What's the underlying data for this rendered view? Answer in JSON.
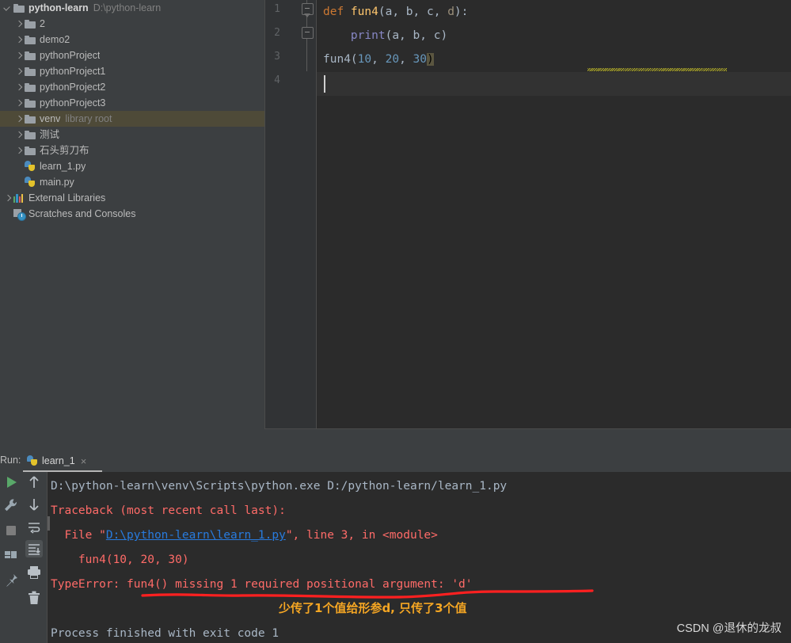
{
  "project": {
    "root": {
      "name": "python-learn",
      "path": "D:\\python-learn",
      "icon": "folder-icon",
      "expanded": true
    },
    "items": [
      {
        "label": "2",
        "icon": "folder-icon",
        "hint": "",
        "selected": false,
        "arrow": "collapsed"
      },
      {
        "label": "demo2",
        "icon": "folder-icon",
        "hint": "",
        "selected": false,
        "arrow": "collapsed"
      },
      {
        "label": "pythonProject",
        "icon": "folder-icon",
        "hint": "",
        "selected": false,
        "arrow": "collapsed"
      },
      {
        "label": "pythonProject1",
        "icon": "folder-icon",
        "hint": "",
        "selected": false,
        "arrow": "collapsed"
      },
      {
        "label": "pythonProject2",
        "icon": "folder-icon",
        "hint": "",
        "selected": false,
        "arrow": "collapsed"
      },
      {
        "label": "pythonProject3",
        "icon": "folder-icon",
        "hint": "",
        "selected": false,
        "arrow": "collapsed"
      },
      {
        "label": "venv",
        "icon": "folder-icon",
        "hint": "library root",
        "selected": true,
        "arrow": "collapsed"
      },
      {
        "label": "测试",
        "icon": "folder-icon",
        "hint": "",
        "selected": false,
        "arrow": "collapsed"
      },
      {
        "label": "石头剪刀布",
        "icon": "folder-icon",
        "hint": "",
        "selected": false,
        "arrow": "collapsed"
      },
      {
        "label": "learn_1.py",
        "icon": "python-file-icon",
        "hint": "",
        "selected": false,
        "arrow": "none"
      },
      {
        "label": "main.py",
        "icon": "python-file-icon",
        "hint": "",
        "selected": false,
        "arrow": "none"
      },
      {
        "label": "External Libraries",
        "icon": "library-icon",
        "hint": "",
        "selected": false,
        "arrow": "collapsed"
      },
      {
        "label": "Scratches and Consoles",
        "icon": "scratches-icon",
        "hint": "",
        "selected": false,
        "arrow": "none"
      }
    ]
  },
  "editor": {
    "line_numbers": [
      "1",
      "2",
      "3",
      "4"
    ],
    "lines": [
      {
        "n": 1,
        "tokens": [
          {
            "t": "def ",
            "c": "kw"
          },
          {
            "t": "fun4",
            "c": "fn"
          },
          {
            "t": "(",
            "c": "punct"
          },
          {
            "t": "a",
            "c": "param"
          },
          {
            "t": ", ",
            "c": "punct"
          },
          {
            "t": "b",
            "c": "param"
          },
          {
            "t": ", ",
            "c": "punct"
          },
          {
            "t": "c",
            "c": "param"
          },
          {
            "t": ", ",
            "c": "punct"
          },
          {
            "t": "d",
            "c": "dparam"
          },
          {
            "t": "):",
            "c": "punct"
          }
        ]
      },
      {
        "n": 2,
        "tokens": [
          {
            "t": "    ",
            "c": "punct"
          },
          {
            "t": "print",
            "c": "builtin"
          },
          {
            "t": "(",
            "c": "punct"
          },
          {
            "t": "a",
            "c": "param"
          },
          {
            "t": ", ",
            "c": "punct"
          },
          {
            "t": "b",
            "c": "param"
          },
          {
            "t": ", ",
            "c": "punct"
          },
          {
            "t": "c",
            "c": "param"
          },
          {
            "t": ")",
            "c": "punct"
          }
        ]
      },
      {
        "n": 3,
        "tokens": [
          {
            "t": "fun4",
            "c": "id-u"
          },
          {
            "t": "(",
            "c": "punct"
          },
          {
            "t": "10",
            "c": "num"
          },
          {
            "t": ", ",
            "c": "punct"
          },
          {
            "t": "20",
            "c": "num"
          },
          {
            "t": ", ",
            "c": "punct"
          },
          {
            "t": "30",
            "c": "num"
          },
          {
            "t": ")",
            "c": "brace-hl"
          }
        ]
      },
      {
        "n": 4,
        "tokens": []
      }
    ],
    "plain_text": "def fun4(a, b, c, d):\n    print(a, b, c)\nfun4(10, 20, 30)\n",
    "current_line": 4
  },
  "run_panel": {
    "label": "Run:",
    "tab": {
      "label": "learn_1",
      "icon": "python-file-icon",
      "close": "×"
    },
    "left_toolbar": [
      {
        "name": "run-icon"
      },
      {
        "name": "wrench-icon"
      },
      {
        "name": "stop-icon"
      },
      {
        "name": "layout-icon"
      },
      {
        "name": "pin-icon"
      }
    ],
    "console_toolbar": [
      {
        "name": "arrow-up-icon"
      },
      {
        "name": "arrow-down-icon"
      },
      {
        "name": "soft-wrap-icon"
      },
      {
        "name": "scroll-to-end-icon",
        "active": true
      },
      {
        "name": "print-icon"
      },
      {
        "name": "trash-icon"
      }
    ],
    "console": [
      {
        "segments": [
          {
            "t": "D:\\python-learn\\venv\\Scripts\\python.exe D:/python-learn/learn_1.py",
            "c": "o-gray"
          }
        ]
      },
      {
        "segments": [
          {
            "t": "Traceback (most recent call last):",
            "c": "o-red"
          }
        ]
      },
      {
        "segments": [
          {
            "t": "  File \"",
            "c": "o-red"
          },
          {
            "t": "D:\\python-learn\\learn_1.py",
            "c": "o-link"
          },
          {
            "t": "\", line 3, in <module>",
            "c": "o-red"
          }
        ]
      },
      {
        "segments": [
          {
            "t": "    fun4(10, 20, 30)",
            "c": "o-red"
          }
        ]
      },
      {
        "segments": [
          {
            "t": "TypeError: fun4() missing 1 required positional argument: 'd'",
            "c": "o-red"
          }
        ]
      },
      {
        "segments": [
          {
            "t": "",
            "c": "o-gray"
          }
        ]
      },
      {
        "segments": [
          {
            "t": "Process finished with exit code 1",
            "c": "o-gray"
          }
        ]
      }
    ]
  },
  "annotations": {
    "note_text": "少传了1个值给形参d, 只传了3个值",
    "note_color": "#f5a623",
    "underline_color": "#ff2020",
    "watermark": "CSDN @退休的龙叔"
  },
  "colors": {
    "panel_bg": "#3c3f41",
    "editor_bg": "#2b2b2b",
    "gutter_bg": "#313335",
    "selection": "#4e4a38",
    "error_red": "#ff6b68",
    "link_blue": "#287bde",
    "keyword_orange": "#cc7832",
    "function_yellow": "#ffc66d",
    "number_blue": "#6897bb"
  }
}
